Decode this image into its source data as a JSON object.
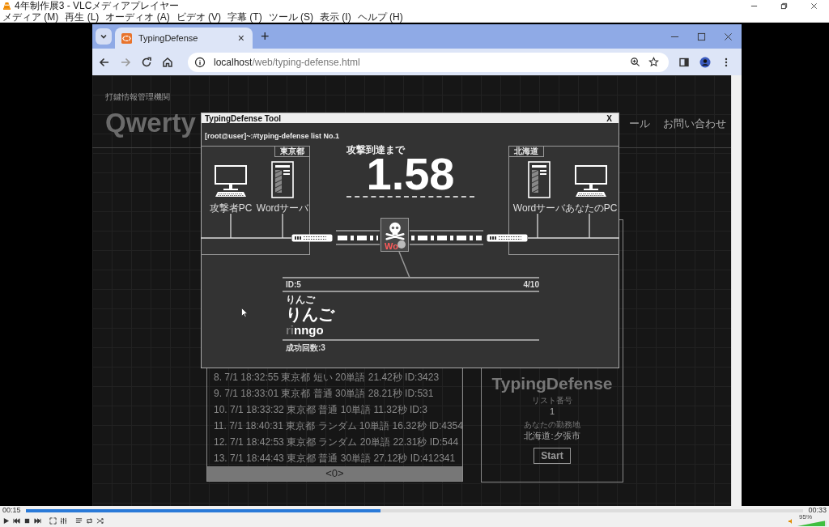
{
  "player": {
    "title": "4年制作展3 - VLCメディアプレイヤー",
    "menu": [
      "メディア (M)",
      "再生 (L)",
      "オーディオ (A)",
      "ビデオ (V)",
      "字幕 (T)",
      "ツール (S)",
      "表示 (I)",
      "ヘルプ (H)"
    ],
    "elapsed": "00:15",
    "total": "00:33",
    "level": 0.456,
    "volume": {
      "level": 0.95,
      "reading": "95%"
    }
  },
  "browser": {
    "tab": {
      "title": "TypingDefense",
      "close": "×"
    },
    "new_tab": "+",
    "url": {
      "host": "localhost",
      "path": "/web/typing-defense.html"
    }
  },
  "page": {
    "org": "打鍵情報管理機関",
    "logo": "Qwerty",
    "nav": [
      "ール",
      "お問い合わせ"
    ],
    "history": [
      "8. 7/1 18:32:55 東京都 短い 20単語 21.42秒 ID:3423",
      "9. 7/1 18:33:01 東京都 普通 30単語 28.21秒 ID:531",
      "10. 7/1 18:33:32 東京都 普通 10単語 11.32秒 ID:3",
      "11. 7/1 18:40:31 東京都 ランダム 10単語 16.32秒 ID:4354",
      "12. 7/1 18:42:53 東京都 ランダム 20単語 22.31秒 ID:544",
      "13. 7/1 18:44:43 東京都 普通 30単語 27.12秒 ID:412341"
    ],
    "pager": "<0>",
    "side": {
      "title": "TypingDefense",
      "list_label": "リスト番号",
      "list_value": "1",
      "location_label": "あなたの勤務地",
      "location_value": "北海道:夕張市",
      "start": "Start"
    }
  },
  "dialog": {
    "title": "TypingDefense Tool",
    "close": "X",
    "prompt": "[root@user]~:#typing-defense list No.1",
    "left_site": {
      "name": "東京都",
      "nodes": [
        {
          "kind": "pc",
          "label": "攻撃者PC"
        },
        {
          "kind": "server",
          "label": "Wordサーバ"
        }
      ]
    },
    "right_site": {
      "name": "北海道",
      "nodes": [
        {
          "kind": "server",
          "label": "Wordサーバ"
        },
        {
          "kind": "pc",
          "label": "あなたのPC"
        }
      ]
    },
    "countdown_label": "攻撃到達まで",
    "countdown": "1.58",
    "virus_label": "Wo",
    "word": {
      "id": "ID:5",
      "progress": "4/10",
      "ruby": "りんご",
      "text": "りんご",
      "typed": "ri",
      "remaining": "nngo",
      "success": "成功回数:3"
    }
  }
}
